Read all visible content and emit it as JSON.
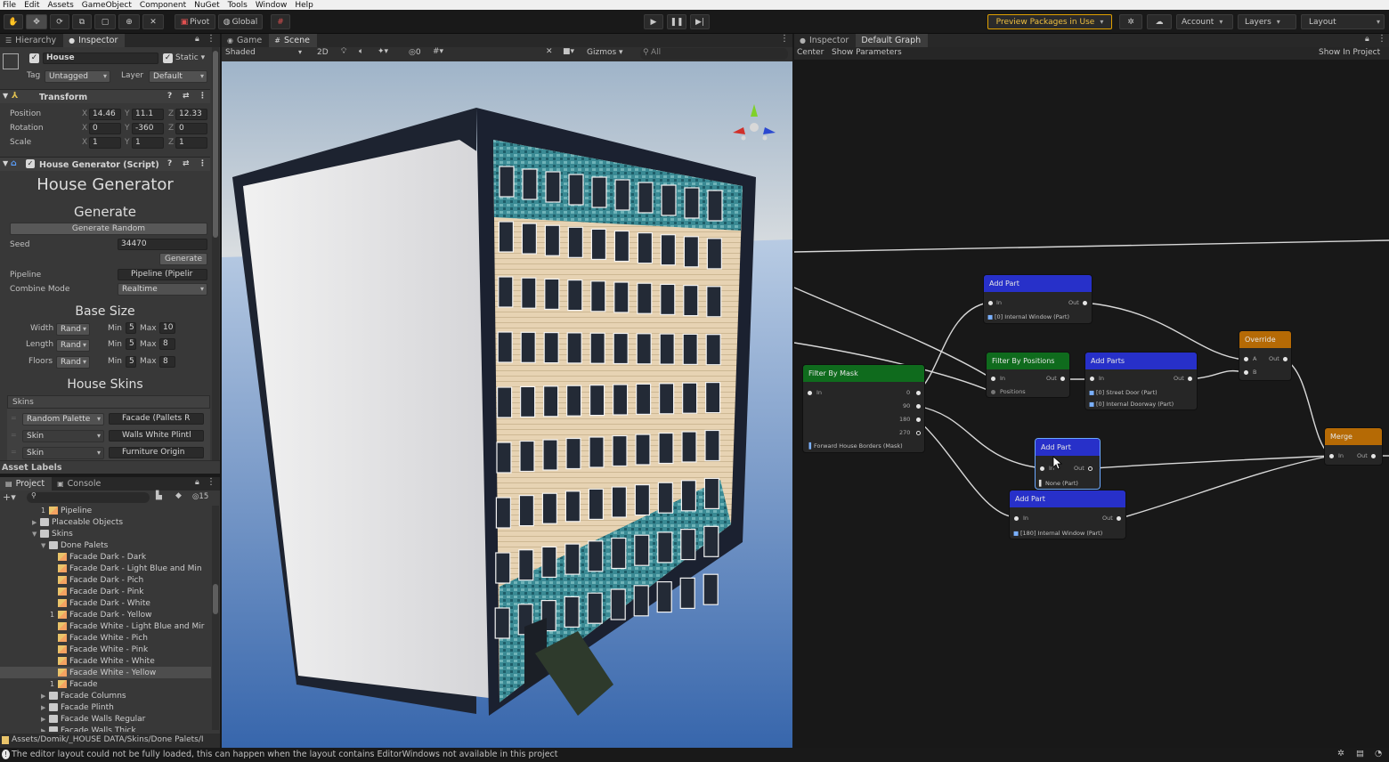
{
  "menu": [
    "File",
    "Edit",
    "Assets",
    "GameObject",
    "Component",
    "NuGet",
    "Tools",
    "Window",
    "Help"
  ],
  "toolbar": {
    "pivot": "Pivot",
    "global": "Global",
    "preview_packages": "Preview Packages in Use",
    "account": "Account",
    "layers": "Layers",
    "layout": "Layout"
  },
  "left_tabs": {
    "hierarchy": "Hierarchy",
    "inspector": "Inspector"
  },
  "inspector": {
    "object_name": "House",
    "static_label": "Static",
    "tag_label": "Tag",
    "tag_value": "Untagged",
    "layer_label": "Layer",
    "layer_value": "Default",
    "transform": {
      "title": "Transform",
      "position_label": "Position",
      "rotation_label": "Rotation",
      "scale_label": "Scale",
      "position": {
        "x": "14.46",
        "y": "11.1",
        "z": "12.33"
      },
      "rotation": {
        "x": "0",
        "y": "-360",
        "z": "0"
      },
      "scale": {
        "x": "1",
        "y": "1",
        "z": "1"
      }
    },
    "script": {
      "title": "House Generator (Script)",
      "heading": "House Generator",
      "generate_heading": "Generate",
      "generate_random_btn": "Generate Random",
      "seed_label": "Seed",
      "seed_value": "34470",
      "generate_btn": "Generate",
      "pipeline_label": "Pipeline",
      "pipeline_value": "Pipeline (Pipelir",
      "combine_label": "Combine Mode",
      "combine_value": "Realtime",
      "base_size_heading": "Base Size",
      "width_label": "Width",
      "length_label": "Length",
      "floors_label": "Floors",
      "rand": "Rand",
      "min_label": "Min",
      "max_label": "Max",
      "width_min": "5",
      "width_max": "10",
      "length_min": "5",
      "length_max": "8",
      "floors_min": "5",
      "floors_max": "8",
      "skins_heading": "House Skins",
      "skins_label": "Skins",
      "skin_rows": [
        {
          "type": "Random Palette",
          "value": "Facade (Pallets R"
        },
        {
          "type": "Skin",
          "value": "Walls White Plintl"
        },
        {
          "type": "Skin",
          "value": "Furniture Origin"
        }
      ]
    },
    "asset_labels": "Asset Labels"
  },
  "project": {
    "tabs": {
      "project": "Project",
      "console": "Console"
    },
    "hidden_count": "15",
    "items": [
      {
        "label": "Pipeline",
        "kind": "asset",
        "depth": 4,
        "badge": "1"
      },
      {
        "label": "Placeable Objects",
        "kind": "folder",
        "depth": 3
      },
      {
        "label": "Skins",
        "kind": "folder",
        "depth": 3,
        "open": true
      },
      {
        "label": "Done Palets",
        "kind": "folder",
        "depth": 4,
        "open": true
      },
      {
        "label": "Facade Dark - Dark",
        "kind": "palette",
        "depth": 5
      },
      {
        "label": "Facade Dark - Light Blue and Min",
        "kind": "palette",
        "depth": 5
      },
      {
        "label": "Facade Dark - Pich",
        "kind": "palette",
        "depth": 5
      },
      {
        "label": "Facade Dark - Pink",
        "kind": "palette",
        "depth": 5
      },
      {
        "label": "Facade Dark - White",
        "kind": "palette",
        "depth": 5
      },
      {
        "label": "Facade Dark - Yellow",
        "kind": "palette",
        "depth": 5,
        "badge": "1"
      },
      {
        "label": "Facade White - Light Blue and Mir",
        "kind": "palette",
        "depth": 5
      },
      {
        "label": "Facade White - Pich",
        "kind": "palette",
        "depth": 5
      },
      {
        "label": "Facade White - Pink",
        "kind": "palette",
        "depth": 5
      },
      {
        "label": "Facade White - White",
        "kind": "palette",
        "depth": 5
      },
      {
        "label": "Facade White - Yellow",
        "kind": "palette",
        "depth": 5,
        "selected": true
      },
      {
        "label": "Facade",
        "kind": "asset",
        "depth": 5,
        "badge": "1"
      },
      {
        "label": "Facade Columns",
        "kind": "folder",
        "depth": 4
      },
      {
        "label": "Facade Plinth",
        "kind": "folder",
        "depth": 4
      },
      {
        "label": "Facade Walls Regular",
        "kind": "folder",
        "depth": 4
      },
      {
        "label": "Facade Walls Thick",
        "kind": "folder",
        "depth": 4
      }
    ],
    "path": "Assets/Domik/_HOUSE DATA/Skins/Done Palets/I"
  },
  "scene": {
    "tabs": {
      "game": "Game",
      "scene": "Scene"
    },
    "shading": "Shaded",
    "mode_2d": "2D",
    "hidden_count": "0",
    "gizmos": "Gizmos",
    "search_placeholder": "All"
  },
  "graph": {
    "tabs": {
      "inspector": "Inspector",
      "graph": "Default Graph"
    },
    "center": "Center",
    "show_params": "Show Parameters",
    "show_in_project": "Show In Project",
    "nodes": {
      "add_part_top": {
        "title": "Add Part",
        "in": "In",
        "out": "Out",
        "param": "[0] Internal Window (Part)"
      },
      "filter_positions": {
        "title": "Filter By Positions",
        "in": "In",
        "out": "Out",
        "positions": "Positions"
      },
      "add_parts": {
        "title": "Add Parts",
        "in": "In",
        "out": "Out",
        "param1": "[0] Street Door (Part)",
        "param2": "[0] Internal Doorway (Part)"
      },
      "override": {
        "title": "Override",
        "a": "A",
        "b": "B",
        "out": "Out"
      },
      "filter_mask": {
        "title": "Filter By Mask",
        "in": "In",
        "o0": "0",
        "o90": "90",
        "o180": "180",
        "o270": "270",
        "param": "Forward House Borders (Mask)"
      },
      "add_part_mid": {
        "title": "Add Part",
        "in": "In",
        "out": "Out",
        "param": "None (Part)"
      },
      "add_part_bottom": {
        "title": "Add Part",
        "in": "In",
        "out": "Out",
        "param": "[180] Internal Window (Part)"
      },
      "merge": {
        "title": "Merge",
        "in": "In",
        "out": "Out"
      }
    }
  },
  "status_message": "The editor layout could not be fully loaded, this can happen when the layout contains EditorWindows not available in this project",
  "colors": {
    "add_part": "#2730c9",
    "filter": "#0f6b1d",
    "override": "#b56a05",
    "preview_border": "#e0a000"
  }
}
